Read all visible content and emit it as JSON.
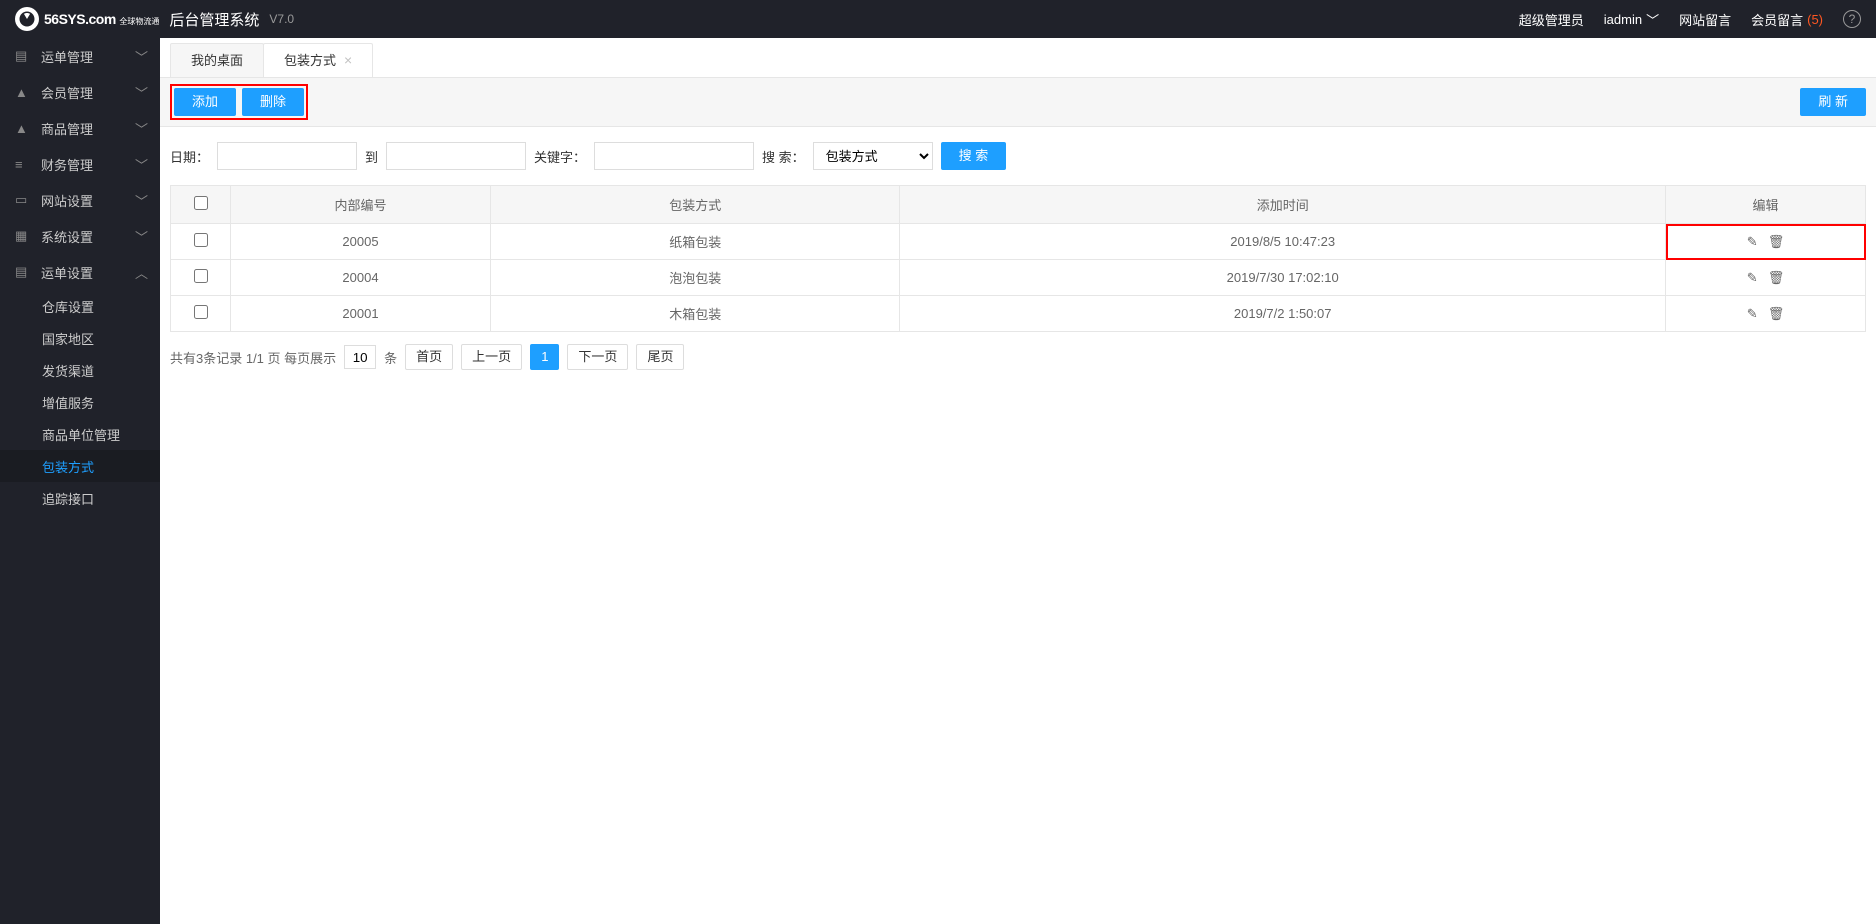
{
  "header": {
    "logo_main": "56SYS",
    "logo_sub": ".com",
    "logo_tag": "全球物流通",
    "title": "后台管理系统",
    "version": "V7.0",
    "role": "超级管理员",
    "user": "iadmin",
    "site_msg": "网站留言",
    "member_msg": "会员留言",
    "member_msg_count": "(5)"
  },
  "sidebar": {
    "items": [
      {
        "label": "运单管理",
        "icon": "doc"
      },
      {
        "label": "会员管理",
        "icon": "user"
      },
      {
        "label": "商品管理",
        "icon": "user"
      },
      {
        "label": "财务管理",
        "icon": "bars"
      },
      {
        "label": "网站设置",
        "icon": "layout"
      },
      {
        "label": "系统设置",
        "icon": "grid"
      },
      {
        "label": "运单设置",
        "icon": "doc",
        "expanded": true
      }
    ],
    "sub": [
      {
        "label": "仓库设置"
      },
      {
        "label": "国家地区"
      },
      {
        "label": "发货渠道"
      },
      {
        "label": "增值服务"
      },
      {
        "label": "商品单位管理"
      },
      {
        "label": "包装方式",
        "active": true
      },
      {
        "label": "追踪接口"
      }
    ]
  },
  "tabs": [
    {
      "label": "我的桌面",
      "active": true,
      "closable": false
    },
    {
      "label": "包装方式",
      "active": false,
      "closable": true
    }
  ],
  "toolbar": {
    "add": "添加",
    "delete": "删除",
    "refresh": "刷 新"
  },
  "search": {
    "date_label": "日期：",
    "to": "到",
    "keyword_label": "关键字：",
    "search_label": "搜 索：",
    "select_value": "包装方式",
    "search_btn": "搜 索"
  },
  "table": {
    "headers": {
      "code": "内部编号",
      "method": "包装方式",
      "time": "添加时间",
      "edit": "编辑"
    },
    "rows": [
      {
        "code": "20005",
        "method": "纸箱包装",
        "time": "2019/8/5 10:47:23",
        "highlight": true
      },
      {
        "code": "20004",
        "method": "泡泡包装",
        "time": "2019/7/30 17:02:10"
      },
      {
        "code": "20001",
        "method": "木箱包装",
        "time": "2019/7/2 1:50:07"
      }
    ]
  },
  "pagination": {
    "summary": "共有3条记录  1/1 页  每页展示",
    "per_page": "10",
    "per_page_suffix": "条",
    "first": "首页",
    "prev": "上一页",
    "current": "1",
    "next": "下一页",
    "last": "尾页"
  }
}
